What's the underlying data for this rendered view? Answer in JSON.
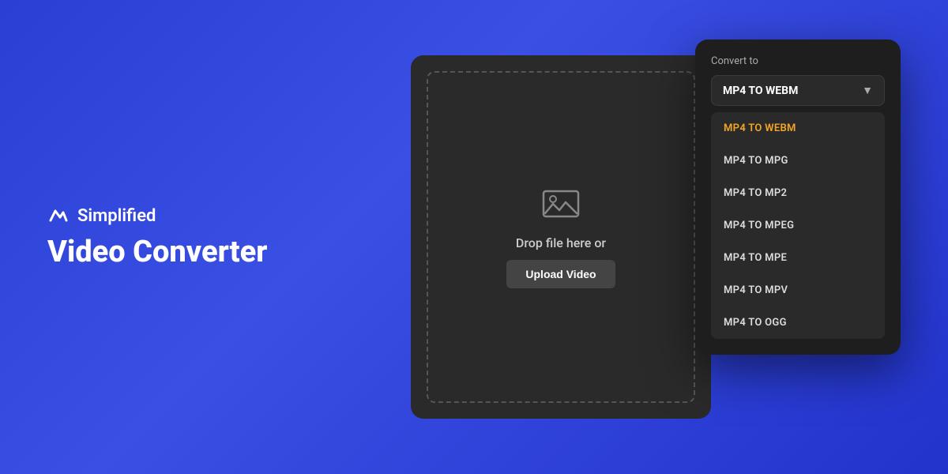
{
  "branding": {
    "logo_icon_alt": "simplified-logo-icon",
    "brand_name": "Simplified",
    "title_line1": "Video Converter"
  },
  "converter": {
    "convert_to_label": "Convert to",
    "selected_option": "MP4 TO WEBM",
    "chevron_icon": "▼",
    "options": [
      {
        "label": "MP4 TO WEBM",
        "active": true
      },
      {
        "label": "MP4 TO MPG",
        "active": false
      },
      {
        "label": "MP4 TO MP2",
        "active": false
      },
      {
        "label": "MP4 TO MPEG",
        "active": false
      },
      {
        "label": "MP4 TO MPE",
        "active": false
      },
      {
        "label": "MP4 TO MPV",
        "active": false
      },
      {
        "label": "MP4 TO OGG",
        "active": false
      }
    ]
  },
  "dropzone": {
    "drop_text": "Drop file here or",
    "upload_button_label": "Upload Video",
    "icon": "🖼"
  }
}
